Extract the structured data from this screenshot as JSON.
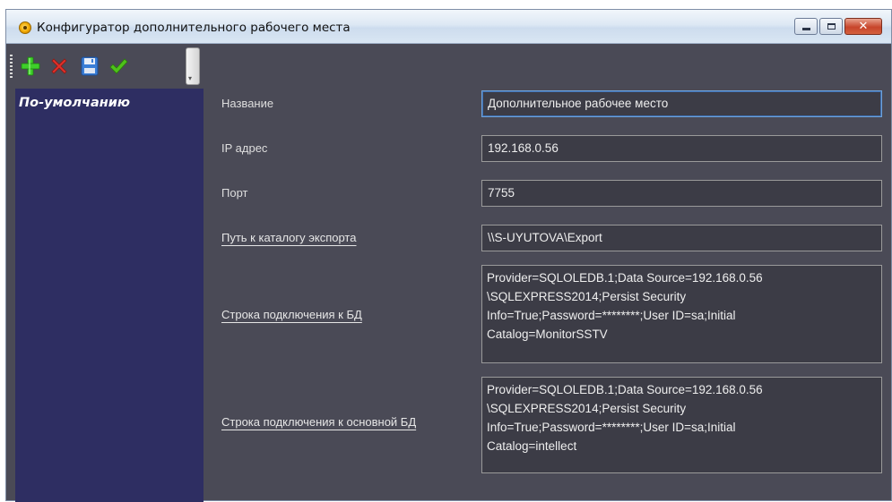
{
  "window": {
    "title": "Конфигуратор дополнительного рабочего места",
    "buttons": {
      "minimize": "minimize",
      "maximize": "maximize",
      "close": "close"
    }
  },
  "toolbar": {
    "add_icon": "plus-icon",
    "delete_icon": "x-icon",
    "save_icon": "floppy-disk-icon",
    "apply_icon": "checkmark-icon",
    "accent_colors": {
      "add": "#3ecf2a",
      "delete": "#e0302a",
      "apply": "#4ec21a"
    }
  },
  "sidebar": {
    "items": [
      {
        "label": "По-умолчанию",
        "selected": true
      }
    ]
  },
  "form": {
    "name_label": "Название",
    "name_value": "Дополнительное рабочее место",
    "ip_label": "IP адрес",
    "ip_value": "192.168.0.56",
    "port_label": "Порт",
    "port_value": "7755",
    "export_label": "Путь к каталогу экспорта",
    "export_value": "\\\\S-UYUTOVA\\Export",
    "db_label": "Строка подключения к БД",
    "db_value": "Provider=SQLOLEDB.1;Data Source=192.168.0.56\n\\SQLEXPRESS2014;Persist Security\nInfo=True;Password=********;User ID=sa;Initial\nCatalog=MonitorSSTV",
    "main_db_label": "Строка подключения к основной БД",
    "main_db_value": "Provider=SQLOLEDB.1;Data Source=192.168.0.56\n\\SQLEXPRESS2014;Persist Security\nInfo=True;Password=********;User ID=sa;Initial\nCatalog=intellect"
  },
  "colors": {
    "background": "#4a4a56",
    "sidebar": "#2e2e62",
    "field_border": "#9a9a9a"
  }
}
